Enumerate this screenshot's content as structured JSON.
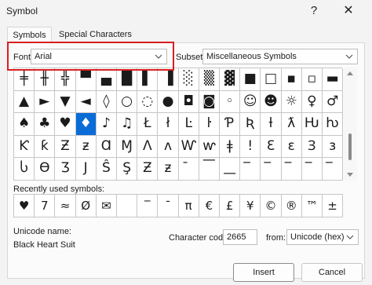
{
  "window": {
    "title": "Symbol",
    "help_glyph": "?",
    "close_glyph": "✕"
  },
  "tabs": [
    {
      "label": "Symbols",
      "active": true
    },
    {
      "label": "Special Characters",
      "active": false
    }
  ],
  "font": {
    "label": "Font:",
    "value": "Arial"
  },
  "subset": {
    "label": "Subset:",
    "value": "Miscellaneous Symbols"
  },
  "symbol_grid": {
    "columns": 16,
    "rows": 5,
    "selected_row": 2,
    "selected_col": 3,
    "cells": [
      [
        "╪",
        "╫",
        "╬",
        "▀",
        "▄",
        "█",
        "▌",
        "▐",
        "░",
        "▒",
        "▓",
        "■",
        "□",
        "▪",
        "▫",
        "▬"
      ],
      [
        "▲",
        "►",
        "▼",
        "◄",
        "◊",
        "○",
        "◌",
        "●",
        "◘",
        "◙",
        "◦",
        "☺",
        "☻",
        "☼",
        "♀",
        "♂"
      ],
      [
        "♠",
        "♣",
        "♥",
        "♦",
        "♪",
        "♫",
        "Ł",
        "ł",
        "Ŀ",
        "ŀ",
        "Ƥ",
        "Ʀ",
        "ƚ",
        "ƛ",
        "Ƕ",
        "ƕ"
      ],
      [
        "Ƙ",
        "ƙ",
        "Ƶ",
        "ƶ",
        "Ɑ",
        "Ɱ",
        "Ʌ",
        "ʌ",
        "Ⱳ",
        "ⱳ",
        "ǂ",
        "ǃ",
        "Ɛ",
        "ɛ",
        "Ɜ",
        "ɜ"
      ],
      [
        "Ⴑ",
        "Ө",
        "Ӡ",
        "Ј",
        "Ŝ",
        "Ş",
        "Ƶ",
        "ƶ",
        "̄",
        "͞",
        "͟",
        "̅",
        "̅",
        "̅",
        "̅",
        "̅"
      ]
    ]
  },
  "recently_used": {
    "label": "Recently used symbols:",
    "symbols": [
      "♥",
      "7",
      "≈",
      "Ø",
      "✉",
      "",
      "‾",
      "ˉ",
      "π",
      "€",
      "£",
      "¥",
      "©",
      "®",
      "™",
      "±"
    ]
  },
  "unicode": {
    "name_label": "Unicode name:",
    "name_value": "Black Heart Suit",
    "code_label": "Character code:",
    "code_value": "2665",
    "from_label": "from:",
    "from_value": "Unicode (hex)"
  },
  "buttons": {
    "insert": "Insert",
    "cancel": "Cancel"
  }
}
